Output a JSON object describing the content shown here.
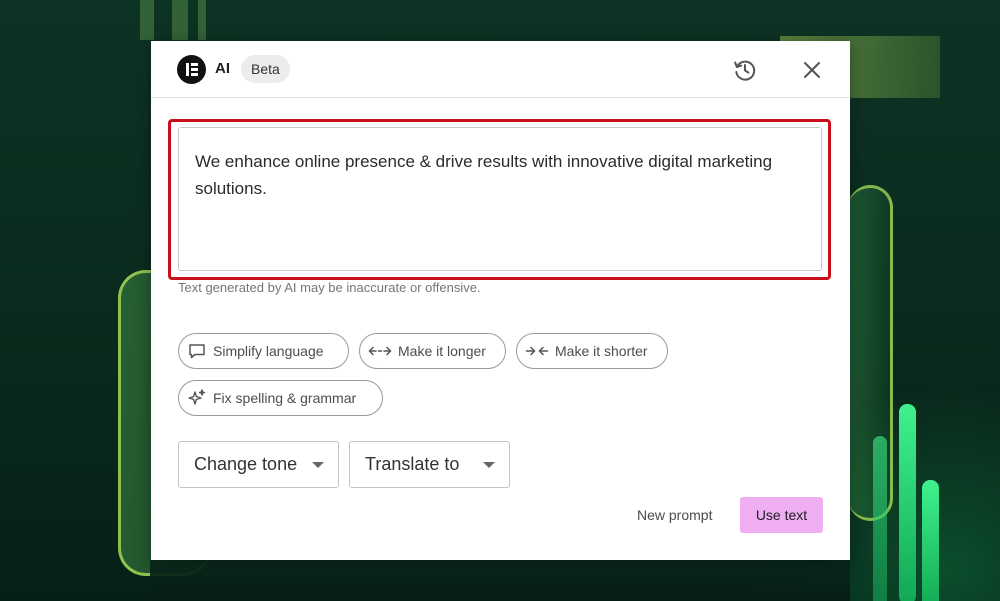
{
  "header": {
    "logo_icon": "elementor-logo-icon",
    "title": "AI",
    "badge": "Beta",
    "history_icon": "history-icon",
    "close_icon": "close-icon"
  },
  "result": {
    "text": "We enhance online presence & drive results with innovative digital marketing solutions.",
    "highlight_color": "#c90f1c"
  },
  "disclaimer": "Text generated by AI may be inaccurate or offensive.",
  "actions": [
    {
      "label": "Simplify language",
      "icon": "speech-bubble-icon"
    },
    {
      "label": "Make it longer",
      "icon": "expand-arrows-icon"
    },
    {
      "label": "Make it shorter",
      "icon": "shrink-arrows-icon"
    },
    {
      "label": "Fix spelling & grammar",
      "icon": "sparkles-icon"
    }
  ],
  "dropdowns": [
    {
      "label": "Change tone"
    },
    {
      "label": "Translate to"
    }
  ],
  "footer": {
    "new_prompt": "New prompt",
    "use_text": "Use text",
    "accent_color": "#efaef2"
  }
}
